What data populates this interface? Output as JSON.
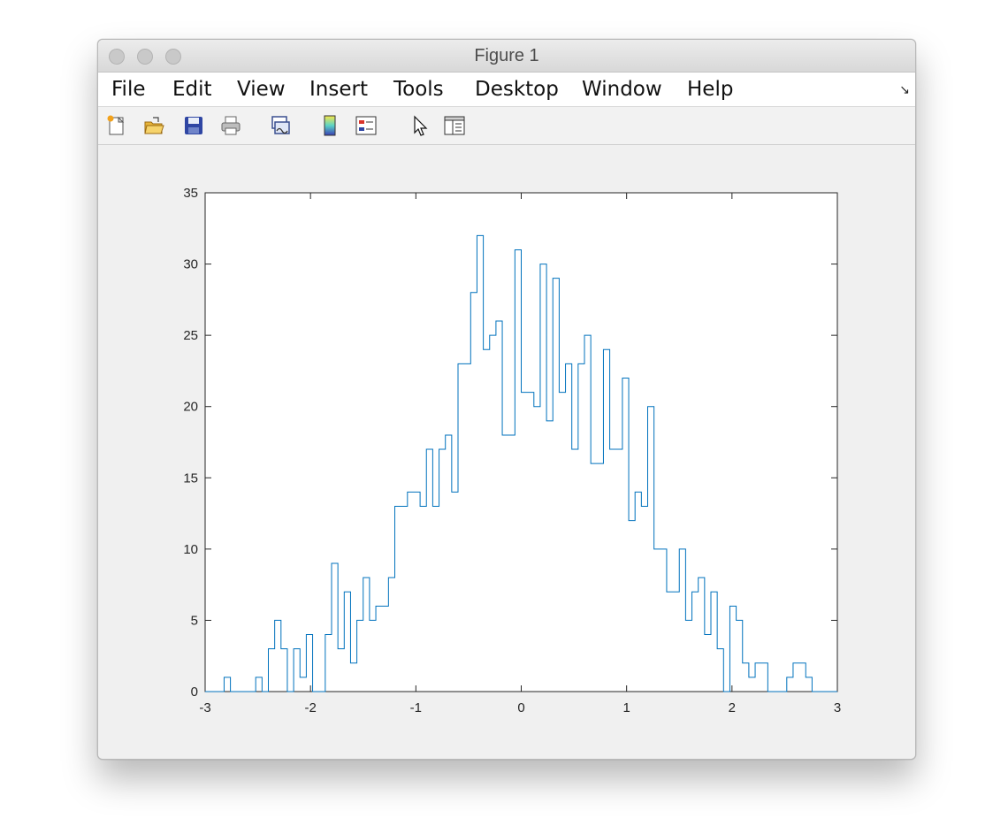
{
  "window": {
    "title": "Figure 1"
  },
  "menu": {
    "items": [
      {
        "key": "file",
        "label": "File"
      },
      {
        "key": "edit",
        "label": "Edit"
      },
      {
        "key": "view",
        "label": "View"
      },
      {
        "key": "insert",
        "label": "Insert"
      },
      {
        "key": "tools",
        "label": "Tools"
      },
      {
        "key": "desktop",
        "label": "Desktop"
      },
      {
        "key": "window",
        "label": "Window"
      },
      {
        "key": "help",
        "label": "Help"
      }
    ]
  },
  "toolbar": {
    "icons": [
      "new-figure-icon",
      "open-file-icon",
      "save-icon",
      "print-icon",
      "link-plot-icon",
      "colorbar-icon",
      "legend-icon",
      "pointer-icon",
      "property-inspector-icon"
    ]
  },
  "chart_data": {
    "type": "stairs-histogram",
    "series_color": "#0072bd",
    "xlim": [
      -3,
      3
    ],
    "ylim": [
      0,
      35
    ],
    "xticks": [
      -3,
      -2,
      -1,
      0,
      1,
      2,
      3
    ],
    "yticks": [
      0,
      5,
      10,
      15,
      20,
      25,
      30,
      35
    ],
    "xticklabels": [
      "-3",
      "-2",
      "-1",
      "0",
      "1",
      "2",
      "3"
    ],
    "yticklabels": [
      "0",
      "5",
      "10",
      "15",
      "20",
      "25",
      "30",
      "35"
    ],
    "bin_width": 0.06,
    "bin_start": -3.0,
    "counts": [
      0,
      0,
      0,
      1,
      0,
      0,
      0,
      0,
      1,
      0,
      3,
      5,
      3,
      0,
      3,
      1,
      4,
      0,
      0,
      4,
      9,
      3,
      7,
      2,
      5,
      8,
      5,
      6,
      6,
      8,
      13,
      13,
      14,
      14,
      13,
      17,
      13,
      17,
      18,
      14,
      23,
      23,
      28,
      32,
      24,
      25,
      26,
      18,
      18,
      31,
      21,
      21,
      20,
      30,
      19,
      29,
      21,
      23,
      17,
      23,
      25,
      16,
      16,
      24,
      17,
      17,
      22,
      12,
      14,
      13,
      20,
      10,
      10,
      7,
      7,
      10,
      5,
      7,
      8,
      4,
      7,
      3,
      0,
      6,
      5,
      2,
      1,
      2,
      2,
      0,
      0,
      0,
      1,
      2,
      2,
      1,
      0,
      0,
      0,
      0
    ]
  }
}
